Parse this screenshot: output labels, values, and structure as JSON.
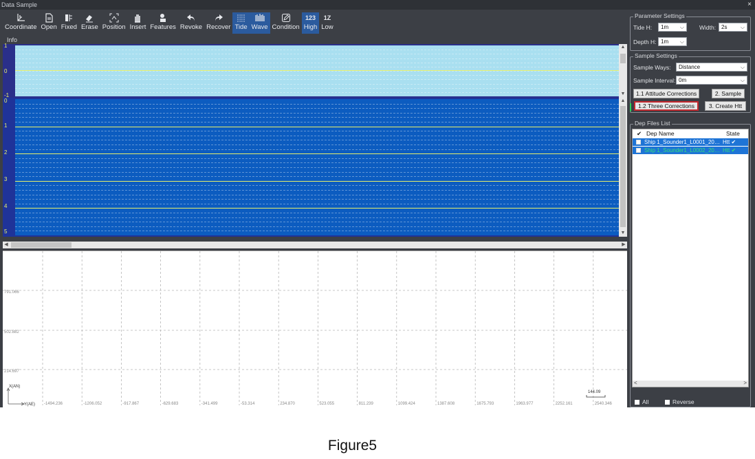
{
  "window": {
    "title": "Data Sample",
    "close": "×"
  },
  "toolbar": [
    {
      "label": "Coordinate",
      "icon": "coordinate-icon"
    },
    {
      "label": "Open",
      "icon": "open-file-icon"
    },
    {
      "label": "Fixed",
      "icon": "fixed-icon"
    },
    {
      "label": "Erase",
      "icon": "eraser-icon"
    },
    {
      "label": "Position",
      "icon": "position-icon"
    },
    {
      "label": "Insert",
      "icon": "hand-icon"
    },
    {
      "label": "Features",
      "icon": "features-icon"
    },
    {
      "label": "Revoke",
      "icon": "undo-icon"
    },
    {
      "label": "Recover",
      "icon": "redo-icon"
    },
    {
      "label": "Tide",
      "icon": "tide-icon",
      "active": true
    },
    {
      "label": "Wave",
      "icon": "wave-icon",
      "active": true
    },
    {
      "label": "Condition",
      "icon": "edit-icon"
    },
    {
      "label": "High",
      "icon": "high-icon",
      "text": "123",
      "active": true
    },
    {
      "label": "Low",
      "icon": "low-icon",
      "text": "1Z"
    }
  ],
  "info_label": "Info",
  "tide_pane": {
    "ticks": [
      "1",
      "0",
      "-1"
    ]
  },
  "wave_pane": {
    "ticks": [
      "0",
      "1",
      "2",
      "3",
      "4",
      "5"
    ]
  },
  "plot": {
    "y_ticks": [
      "791.066",
      "502.882",
      "214.697"
    ],
    "x_ticks": [
      "-1494.236",
      "-1206.052",
      "-917.867",
      "-629.683",
      "-341.499",
      "-53.314",
      "234.870",
      "523.055",
      "811.239",
      "1099.424",
      "1387.608",
      "1675.793",
      "1963.977",
      "2252.161",
      "2540.346"
    ],
    "axis_y_label": "X(AN)",
    "axis_x_label": "Y(AE)",
    "scale_value": "144.09"
  },
  "parameter_settings": {
    "title": "Parameter Settings",
    "tide_h_label": "Tide H:",
    "tide_h_value": "1m",
    "width_label": "Width:",
    "width_value": "2s",
    "depth_h_label": "Depth H:",
    "depth_h_value": "1m"
  },
  "sample_settings": {
    "title": "Sample Settings",
    "ways_label": "Sample Ways:",
    "ways_value": "Distance",
    "interval_label": "Sample Interval:",
    "interval_value": "0m",
    "btn_attitude": "1.1 Attitude Corrections",
    "btn_sample": "2. Sample",
    "btn_three": "1.2 Three Corrections",
    "btn_create": "3. Create Htt",
    "step_marker": "1"
  },
  "dep_files": {
    "title": "Dep Files List",
    "col_check": "✔",
    "col_name": "Dep Name",
    "col_state": "State",
    "rows": [
      {
        "name": "Ship 1_Sounder1_L0001_202...",
        "state": "Htt ✔",
        "color": "#ffffff"
      },
      {
        "name": "Ship 1_Sounder1_L0002_202...",
        "state": "Htt ✔",
        "color": "#35e07a"
      }
    ],
    "all_label": "All",
    "reverse_label": "Reverse"
  },
  "caption": "Figure5",
  "colors": {
    "tide_bg": "#a9dff0",
    "wave_bg": "#0c5cc0",
    "level_line": "#e8f06a",
    "selected_border": "#c4282e"
  }
}
